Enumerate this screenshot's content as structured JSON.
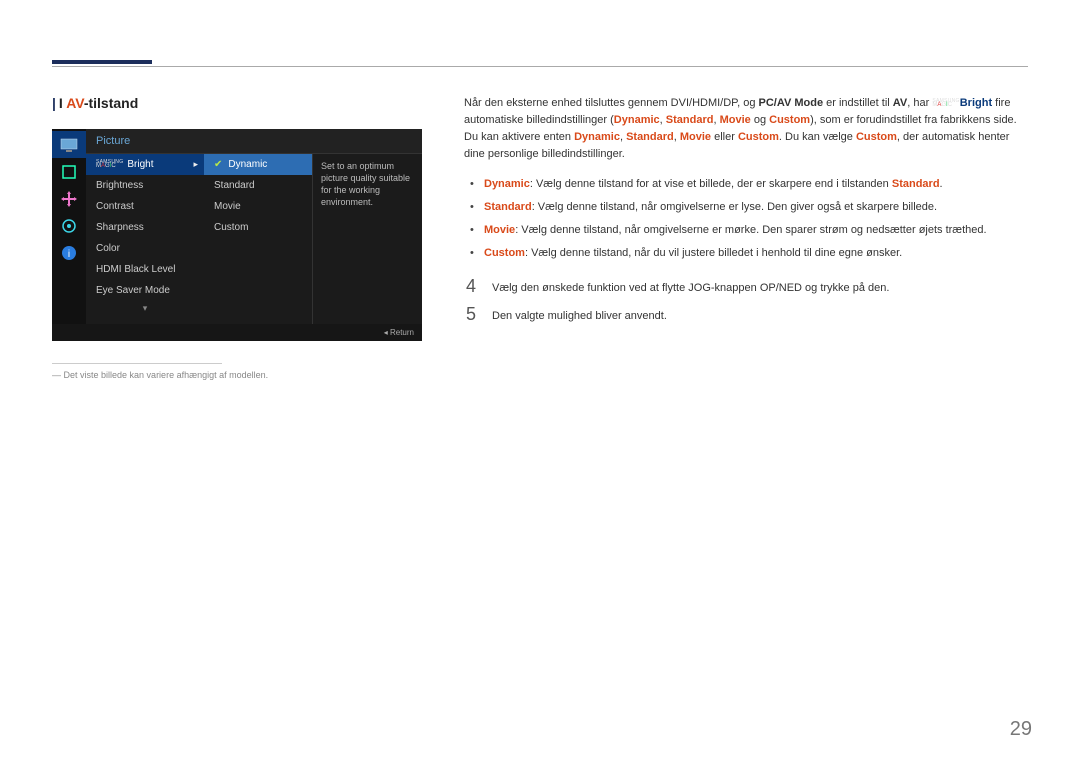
{
  "heading": {
    "bar": "|",
    "prefix": "I ",
    "av": "AV",
    "suffix": "-tilstand"
  },
  "osd": {
    "title": "Picture",
    "col1": {
      "magic_bright": "Bright",
      "items": [
        "Brightness",
        "Contrast",
        "Sharpness",
        "Color",
        "HDMI Black Level",
        "Eye Saver Mode"
      ]
    },
    "col2": [
      "Dynamic",
      "Standard",
      "Movie",
      "Custom"
    ],
    "desc": "Set to an optimum picture quality suitable for the working environment.",
    "down": "▾",
    "return": "Return"
  },
  "footnote": "Det viste billede kan variere afhængigt af modellen.",
  "intro": {
    "p1a": "Når den eksterne enhed tilsluttes gennem DVI/HDMI/DP, og ",
    "pcav": "PC/AV Mode",
    "p1b": " er indstillet til ",
    "av": "AV",
    "p1c": ", har ",
    "bright": "Bright",
    "p1d": " fire automatiske billedindstillinger (",
    "d": "Dynamic",
    "s": "Standard",
    "m": "Movie",
    "o_og": " og ",
    "c": "Custom",
    "p1e": "), som er forudindstillet fra fabrikkens side. Du kan aktivere enten ",
    "p1f": " eller ",
    "p1g": ". Du kan vælge ",
    "p1h": ", der automatisk henter dine personlige billedindstillinger."
  },
  "bullets": [
    {
      "name": "Dynamic",
      "text": ": Vælg denne tilstand for at vise et billede, der er skarpere end i tilstanden ",
      "trail": "Standard",
      "end": "."
    },
    {
      "name": "Standard",
      "text": ": Vælg denne tilstand, når omgivelserne er lyse. Den giver også et skarpere billede.",
      "trail": "",
      "end": ""
    },
    {
      "name": "Movie",
      "text": ": Vælg denne tilstand, når omgivelserne er mørke. Den sparer strøm og nedsætter øjets træthed.",
      "trail": "",
      "end": ""
    },
    {
      "name": "Custom",
      "text": ": Vælg denne tilstand, når du vil justere billedet i henhold til dine egne ønsker.",
      "trail": "",
      "end": ""
    }
  ],
  "steps": {
    "s4n": "4",
    "s4": "Vælg den ønskede funktion ved at flytte JOG-knappen OP/NED og trykke på den.",
    "s5n": "5",
    "s5": "Den valgte mulighed bliver anvendt."
  },
  "pagenum": "29"
}
